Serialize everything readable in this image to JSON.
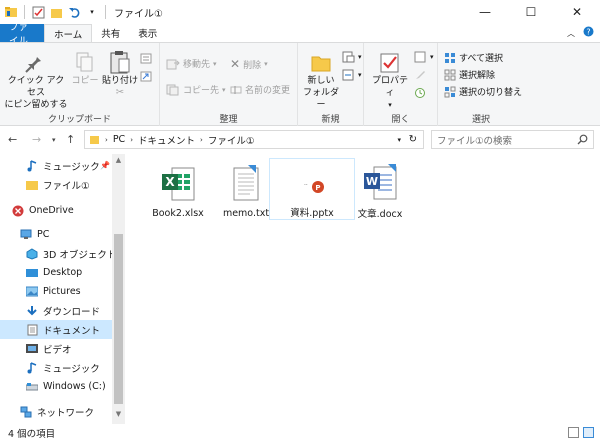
{
  "window": {
    "title": "ファイル①",
    "controls": {
      "minimize": "—",
      "maximize": "☐",
      "close": "✕"
    }
  },
  "tabs": [
    "ファイル",
    "ホーム",
    "共有",
    "表示"
  ],
  "ribbon": {
    "clipboard": {
      "label": "クリップボード",
      "pin_line1": "クイック アクセス",
      "pin_line2": "にピン留めする",
      "copy": "コピー",
      "paste": "貼り付け"
    },
    "organize": {
      "label": "整理",
      "move_to": "移動先",
      "copy_to": "コピー先",
      "delete": "削除",
      "rename": "名前の変更"
    },
    "new": {
      "label": "新規",
      "new_folder_line1": "新しい",
      "new_folder_line2": "フォルダー"
    },
    "open": {
      "label": "開く",
      "properties": "プロパティ"
    },
    "select": {
      "label": "選択",
      "select_all": "すべて選択",
      "select_none": "選択解除",
      "invert": "選択の切り替え"
    }
  },
  "address": {
    "path": [
      "PC",
      "ドキュメント",
      "ファイル①"
    ],
    "search_placeholder": "ファイル①の検索"
  },
  "nav": {
    "items": [
      {
        "label": "ミュージック",
        "icon": "music-icon"
      },
      {
        "label": "ファイル①",
        "icon": "folder-icon"
      },
      {
        "label": "OneDrive",
        "icon": "onedrive-icon"
      },
      {
        "label": "PC",
        "icon": "pc-icon"
      },
      {
        "label": "3D オブジェクト",
        "icon": "3d-objects-icon"
      },
      {
        "label": "Desktop",
        "icon": "desktop-icon"
      },
      {
        "label": "Pictures",
        "icon": "pictures-icon"
      },
      {
        "label": "ダウンロード",
        "icon": "download-icon"
      },
      {
        "label": "ドキュメント",
        "icon": "documents-icon"
      },
      {
        "label": "ビデオ",
        "icon": "video-icon"
      },
      {
        "label": "ミュージック",
        "icon": "music-icon"
      },
      {
        "label": "Windows (C:)",
        "icon": "drive-icon"
      },
      {
        "label": "ネットワーク",
        "icon": "network-icon"
      }
    ]
  },
  "files": [
    {
      "name": "Book2.xlsx",
      "icon": "excel-file-icon"
    },
    {
      "name": "memo.txt",
      "icon": "text-file-icon"
    },
    {
      "name": "資料.pptx",
      "icon": "powerpoint-file-icon"
    },
    {
      "name": "文章.docx",
      "icon": "word-file-icon"
    }
  ],
  "status": {
    "count": "4 個の項目"
  },
  "colors": {
    "accent": "#1979ca",
    "selected": "#cce8ff",
    "excel": "#1d7044",
    "word": "#2b579a",
    "powerpoint": "#d24726"
  }
}
